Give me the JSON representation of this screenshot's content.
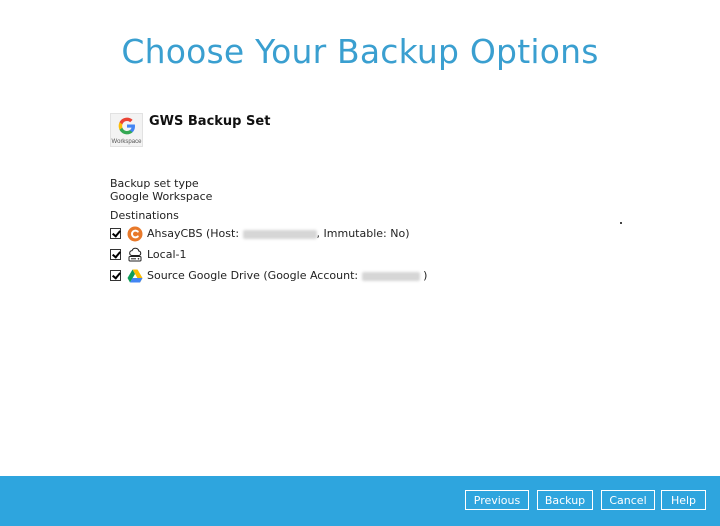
{
  "title": "Choose Your Backup Options",
  "backup_set": {
    "name": "GWS Backup Set",
    "logo_caption": "Workspace",
    "type_label": "Backup set type",
    "type_value": "Google Workspace"
  },
  "destinations": {
    "heading": "Destinations",
    "items": [
      {
        "name": "AhsayCBS",
        "prefix": "AhsayCBS (Host: ",
        "suffix": ", Immutable: No)",
        "checked": true,
        "icon": "ahsay-cbs-icon"
      },
      {
        "name": "Local-1",
        "label": "Local-1",
        "checked": true,
        "icon": "local-drive-icon"
      },
      {
        "name": "Source Google Drive",
        "prefix": "Source Google Drive (Google Account: ",
        "suffix": " )",
        "checked": true,
        "icon": "google-drive-icon"
      }
    ]
  },
  "footer": {
    "previous": "Previous",
    "backup": "Backup",
    "cancel": "Cancel",
    "help": "Help"
  },
  "colors": {
    "title": "#3a9fd0",
    "footer": "#2ea5de",
    "ahsay": "#e8792a"
  }
}
